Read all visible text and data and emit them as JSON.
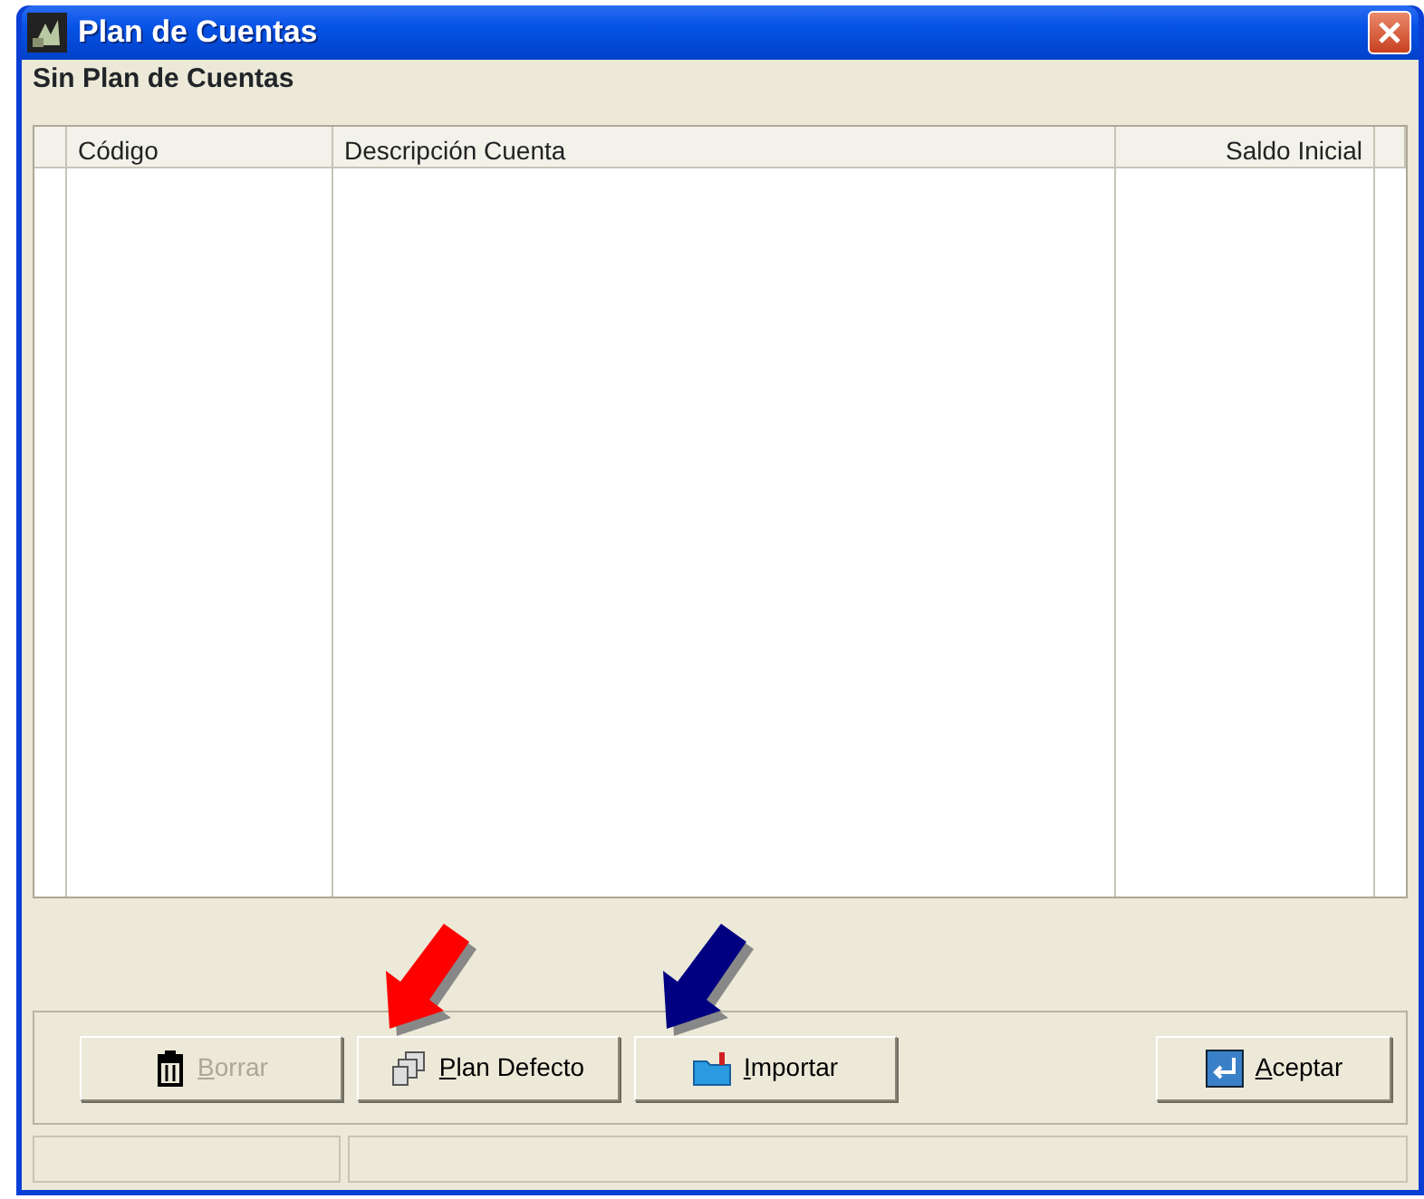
{
  "window": {
    "title": "Plan de Cuentas"
  },
  "subtitle": "Sin Plan de Cuentas",
  "table": {
    "columns": [
      "Código",
      "Descripción Cuenta",
      "Saldo Inicial"
    ]
  },
  "buttons": [
    {
      "label": "Borrar",
      "disabled": true
    },
    {
      "label": "Plan Defecto",
      "disabled": false,
      "pointer": {
        "color": "#ff0000"
      }
    },
    {
      "label": "Importar",
      "disabled": false,
      "pointer": {
        "color": "#000080"
      }
    },
    {
      "label": "Aceptar",
      "disabled": false
    }
  ]
}
